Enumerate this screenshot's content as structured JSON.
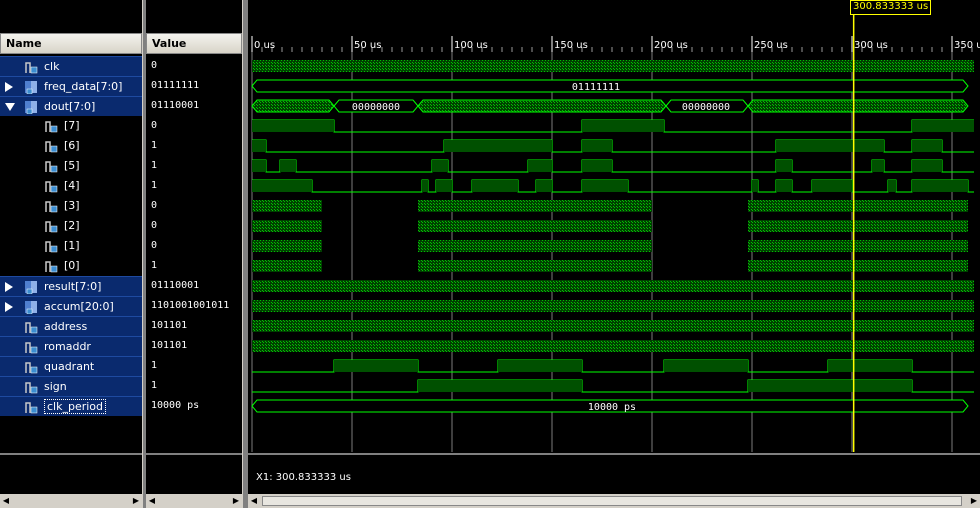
{
  "headers": {
    "name": "Name",
    "value": "Value"
  },
  "signals": [
    {
      "name": "clk",
      "value": "0",
      "type": "bit",
      "expander": "none",
      "selected": true
    },
    {
      "name": "freq_data[7:0]",
      "value": "01111111",
      "type": "bus",
      "expander": "right",
      "selected": true
    },
    {
      "name": "dout[7:0]",
      "value": "01110001",
      "type": "bus",
      "expander": "down",
      "selected": true
    },
    {
      "name": "[7]",
      "value": "0",
      "type": "bit",
      "expander": "none",
      "selected": false
    },
    {
      "name": "[6]",
      "value": "1",
      "type": "bit",
      "expander": "none",
      "selected": false
    },
    {
      "name": "[5]",
      "value": "1",
      "type": "bit",
      "expander": "none",
      "selected": false
    },
    {
      "name": "[4]",
      "value": "1",
      "type": "bit",
      "expander": "none",
      "selected": false
    },
    {
      "name": "[3]",
      "value": "0",
      "type": "bit",
      "expander": "none",
      "selected": false
    },
    {
      "name": "[2]",
      "value": "0",
      "type": "bit",
      "expander": "none",
      "selected": false
    },
    {
      "name": "[1]",
      "value": "0",
      "type": "bit",
      "expander": "none",
      "selected": false
    },
    {
      "name": "[0]",
      "value": "1",
      "type": "bit",
      "expander": "none",
      "selected": false
    },
    {
      "name": "result[7:0]",
      "value": "01110001",
      "type": "bus",
      "expander": "right",
      "selected": true
    },
    {
      "name": "accum[20:0]",
      "value": "1101001001011",
      "type": "bus",
      "expander": "right",
      "selected": true
    },
    {
      "name": "address",
      "value": "101101",
      "type": "bit",
      "expander": "none",
      "selected": true
    },
    {
      "name": "romaddr",
      "value": "101101",
      "type": "bit",
      "expander": "none",
      "selected": true
    },
    {
      "name": "quadrant",
      "value": "1",
      "type": "bit",
      "expander": "none",
      "selected": true
    },
    {
      "name": "sign",
      "value": "1",
      "type": "bit",
      "expander": "none",
      "selected": true
    },
    {
      "name": "clk_period",
      "value": "10000 ps",
      "type": "bit",
      "expander": "none",
      "selected": true
    }
  ],
  "ruler": {
    "labels": [
      "0 us",
      "50 us",
      "100 us",
      "150 us",
      "200 us",
      "250 us",
      "300 us",
      "350 u"
    ],
    "cursor_label": "300.833333 us",
    "cursor_time_us": 300.833333
  },
  "bus_labels": {
    "freq_data": "01111111",
    "dout_a": "00000000",
    "dout_b": "00000000",
    "clk_period": "10000 ps"
  },
  "status": {
    "cursor_readout": "X1: 300.833333 us"
  },
  "colors": {
    "wave": "#00ff00",
    "dense": "#00a000",
    "cursor": "#ffff00",
    "grid": "#ffffff",
    "selected_row": "#0a2a6e"
  },
  "icons": {
    "signal": "signal-icon",
    "expand": "triangle-right-icon",
    "collapse": "triangle-down-icon"
  }
}
